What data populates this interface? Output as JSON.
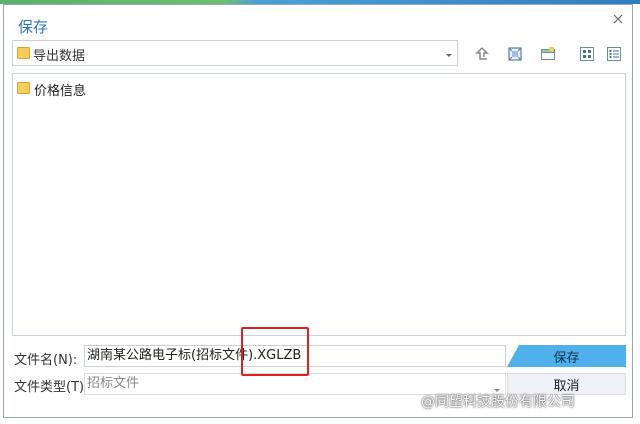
{
  "dialog": {
    "title": "保存"
  },
  "path": {
    "current": "导出数据"
  },
  "files": [
    {
      "name": "价格信息",
      "icon": "folder-icon"
    }
  ],
  "form": {
    "filename_label": "文件名(N):",
    "filename_value": "湖南某公路电子标(招标文件).XGLZB",
    "filetype_label": "文件类型(T):",
    "filetype_value": "招标文件"
  },
  "buttons": {
    "save": "保存",
    "cancel": "取消"
  },
  "watermark": {
    "text": "@同望科技股份有限公司"
  },
  "colors": {
    "title": "#2c74bf",
    "save_button": "#4fb0ec",
    "highlight": "#e02020",
    "folder": "#f5cd5a"
  },
  "icons": {
    "toolbar": [
      "up-folder-icon",
      "fit-view-icon",
      "new-folder-icon",
      "large-icons-view-icon",
      "details-view-icon"
    ],
    "close": "close-icon"
  }
}
